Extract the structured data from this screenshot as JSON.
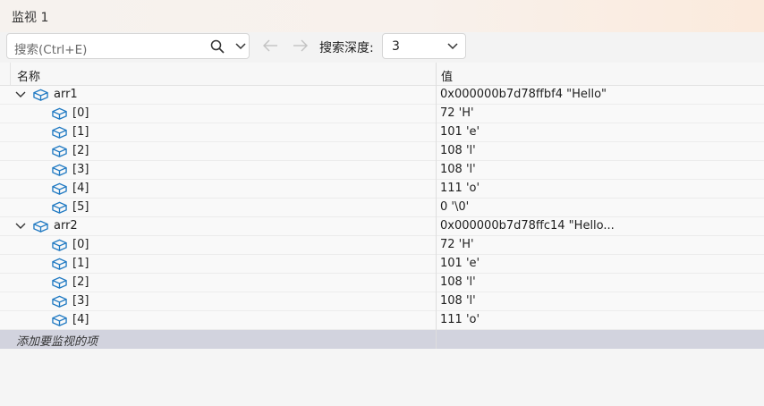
{
  "window": {
    "title": "监视 1"
  },
  "toolbar": {
    "search_placeholder": "搜索(Ctrl+E)",
    "depth_label": "搜索深度:",
    "depth_value": "3"
  },
  "columns": {
    "name": "名称",
    "value": "值"
  },
  "rows": [
    {
      "name": "arr1",
      "value": "0x000000b7d78ffbf4 \"Hello\"",
      "level": 0,
      "expanded": true
    },
    {
      "name": "[0]",
      "value": "72 'H'",
      "level": 1
    },
    {
      "name": "[1]",
      "value": "101 'e'",
      "level": 1
    },
    {
      "name": "[2]",
      "value": "108 'l'",
      "level": 1
    },
    {
      "name": "[3]",
      "value": "108 'l'",
      "level": 1
    },
    {
      "name": "[4]",
      "value": "111 'o'",
      "level": 1
    },
    {
      "name": "[5]",
      "value": "0 '\\0'",
      "level": 1
    },
    {
      "name": "arr2",
      "value": "0x000000b7d78ffc14 \"Hello...",
      "level": 0,
      "expanded": true
    },
    {
      "name": "[0]",
      "value": "72 'H'",
      "level": 1
    },
    {
      "name": "[1]",
      "value": "101 'e'",
      "level": 1
    },
    {
      "name": "[2]",
      "value": "108 'l'",
      "level": 1
    },
    {
      "name": "[3]",
      "value": "108 'l'",
      "level": 1
    },
    {
      "name": "[4]",
      "value": "111 'o'",
      "level": 1
    }
  ],
  "add_item_label": "添加要监视的项",
  "colors": {
    "icon_blue": "#1f79c2",
    "add_row_bg": "#d2d3de"
  }
}
